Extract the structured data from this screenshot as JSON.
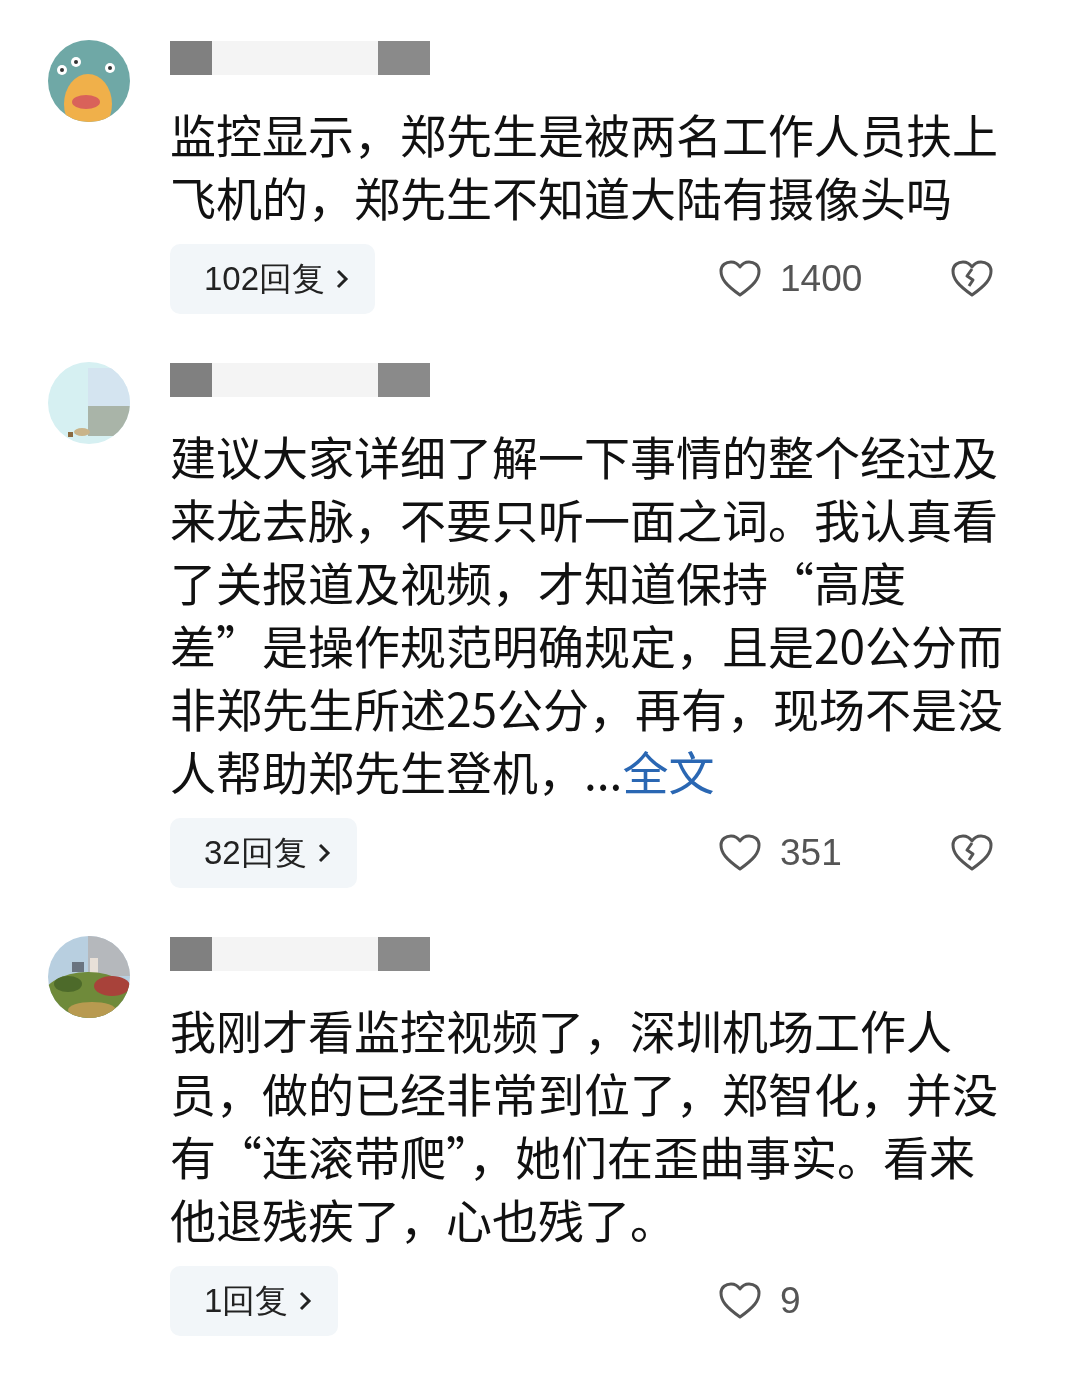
{
  "comments": [
    {
      "text": "监控显示，郑先生是被两名工作人员扶上飞机的，郑先生不知道大陆有摄像头吗",
      "replies": "102回复",
      "likes": "1400",
      "show_dislike": true
    },
    {
      "text": "建议大家详细了解一下事情的整个经过及来龙去脉，不要只听一面之词。我认真看了关报道及视频，才知道保持“高度差”是操作规范明确规定，且是20公分而非郑先生所述25公分，再有，现场不是没人帮助郑先生登机，...",
      "more_link": "全文",
      "replies": "32回复",
      "likes": "351",
      "show_dislike": true
    },
    {
      "text": "我刚才看监控视频了，深圳机场工作人员，做的已经非常到位了，郑智化，并没有“连滚带爬”，她们在歪曲事实。看来他退残疾了，心也残了。",
      "replies": "1回复",
      "likes": "9",
      "show_dislike": false
    }
  ]
}
